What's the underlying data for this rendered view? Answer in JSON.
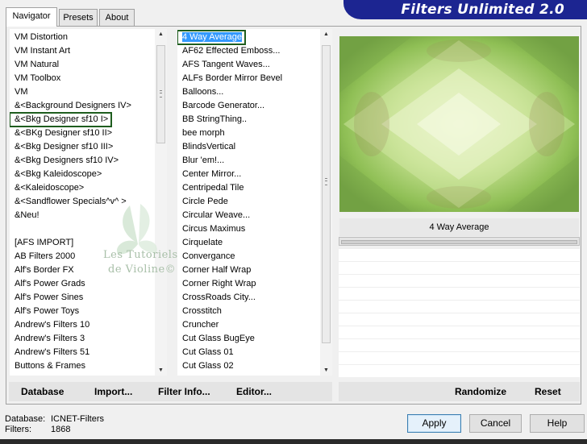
{
  "banner": {
    "title": "Filters Unlimited 2.0"
  },
  "tabs": [
    {
      "label": "Navigator"
    },
    {
      "label": "Presets"
    },
    {
      "label": "About"
    }
  ],
  "categories": [
    "VM Distortion",
    "VM Instant Art",
    "VM Natural",
    "VM Toolbox",
    "VM",
    "&<Background Designers IV>",
    "&<Bkg Designer sf10 I>",
    "&<BKg Designer sf10 II>",
    "&<Bkg Designer sf10 III>",
    "&<Bkg Designers sf10 IV>",
    "&<Bkg Kaleidoscope>",
    "&<Kaleidoscope>",
    "&<Sandflower Specials^v^ >",
    "&Neu!",
    "",
    "[AFS IMPORT]",
    "AB Filters 2000",
    "Alf's Border FX",
    "Alf's Power Grads",
    "Alf's Power Sines",
    "Alf's Power Toys",
    "Andrew's Filters 10",
    "Andrew's Filters 3",
    "Andrew's Filters 51",
    "Buttons & Frames"
  ],
  "filters": [
    "4 Way Average",
    "AF62 Effected Emboss...",
    "AFS Tangent Waves...",
    "ALFs Border Mirror Bevel",
    "Balloons...",
    "Barcode Generator...",
    "BB StringThing..",
    "bee morph",
    "BlindsVertical",
    "Blur 'em!...",
    "Center Mirror...",
    "Centripedal Tile",
    "Circle Pede",
    "Circular Weave...",
    "Circus Maximus",
    "Cirquelate",
    "Convergance",
    "Corner Half Wrap",
    "Corner Right Wrap",
    "CrossRoads City...",
    "Crosstitch",
    "Cruncher",
    "Cut Glass  BugEye",
    "Cut Glass 01",
    "Cut Glass 02"
  ],
  "selected_category_index": 6,
  "selected_filter_index": 0,
  "preview": {
    "filter_name": "4 Way Average"
  },
  "watermark": {
    "line1": "Les Tutoriels",
    "line2": "de Violine©"
  },
  "toolbar": {
    "database": "Database",
    "import": "Import...",
    "filter_info": "Filter Info...",
    "editor": "Editor..."
  },
  "actions": {
    "randomize": "Randomize",
    "reset": "Reset"
  },
  "status": {
    "database_label": "Database:",
    "database_value": "ICNET-Filters",
    "filters_label": "Filters:",
    "filters_value": "1868"
  },
  "buttons": {
    "apply": "Apply",
    "cancel": "Cancel",
    "help": "Help"
  },
  "colors": {
    "banner": "#1c2591",
    "selection_border": "#1e5d1e",
    "highlight": "#3399ff"
  }
}
